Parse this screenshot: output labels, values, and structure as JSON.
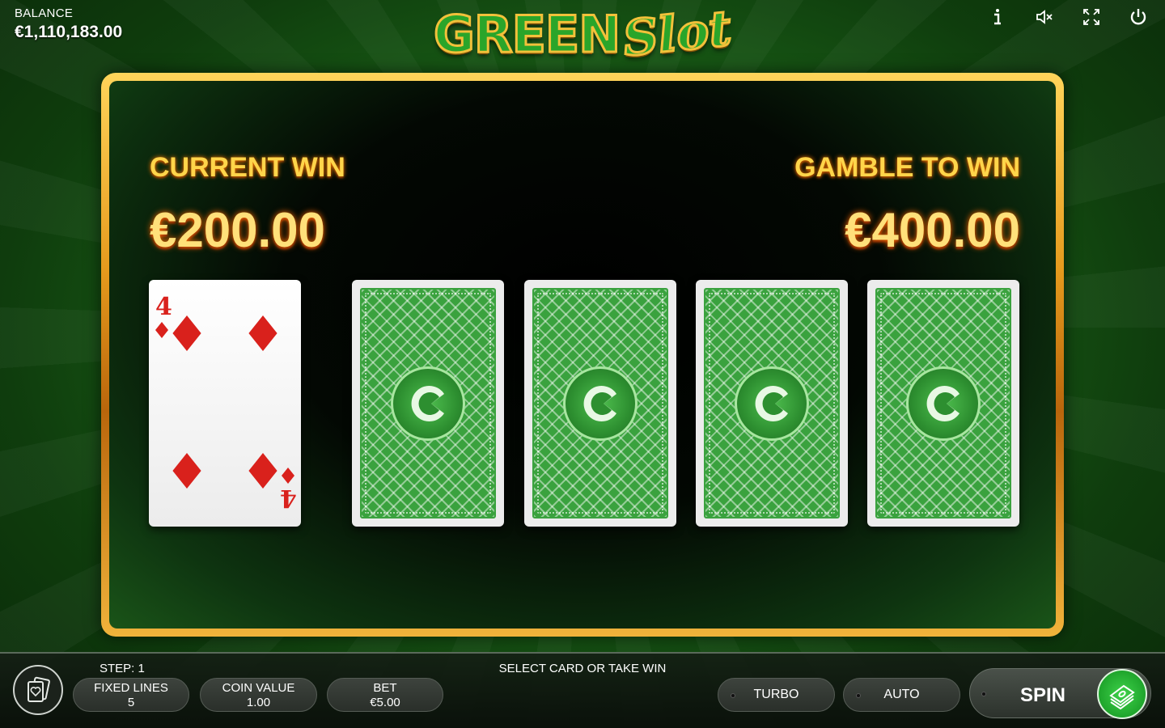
{
  "header": {
    "balance_label": "BALANCE",
    "balance_value": "€1,110,183.00",
    "logo_part1": "GREEN",
    "logo_part2": "Slot"
  },
  "top_icons": [
    "info-icon",
    "sound-muted-icon",
    "fullscreen-icon",
    "power-icon"
  ],
  "gamble": {
    "current_win_label": "CURRENT WIN",
    "current_win_value": "€200.00",
    "gamble_to_win_label": "GAMBLE TO WIN",
    "gamble_to_win_value": "€400.00",
    "dealer_card": {
      "rank": "4",
      "suit": "diamonds"
    },
    "hidden_cards": 4
  },
  "bottom": {
    "step_text": "STEP: 1",
    "status_text": "SELECT CARD OR TAKE WIN",
    "fixed_lines_label": "FIXED LINES",
    "fixed_lines_value": "5",
    "coin_value_label": "COIN VALUE",
    "coin_value_value": "1.00",
    "bet_label": "BET",
    "bet_value": "€5.00",
    "turbo_label": "TURBO",
    "auto_label": "AUTO",
    "spin_label": "SPIN"
  },
  "colors": {
    "gold": "#ffd54a",
    "card_green": "#3aa23e",
    "diamond_red": "#d9211c"
  }
}
